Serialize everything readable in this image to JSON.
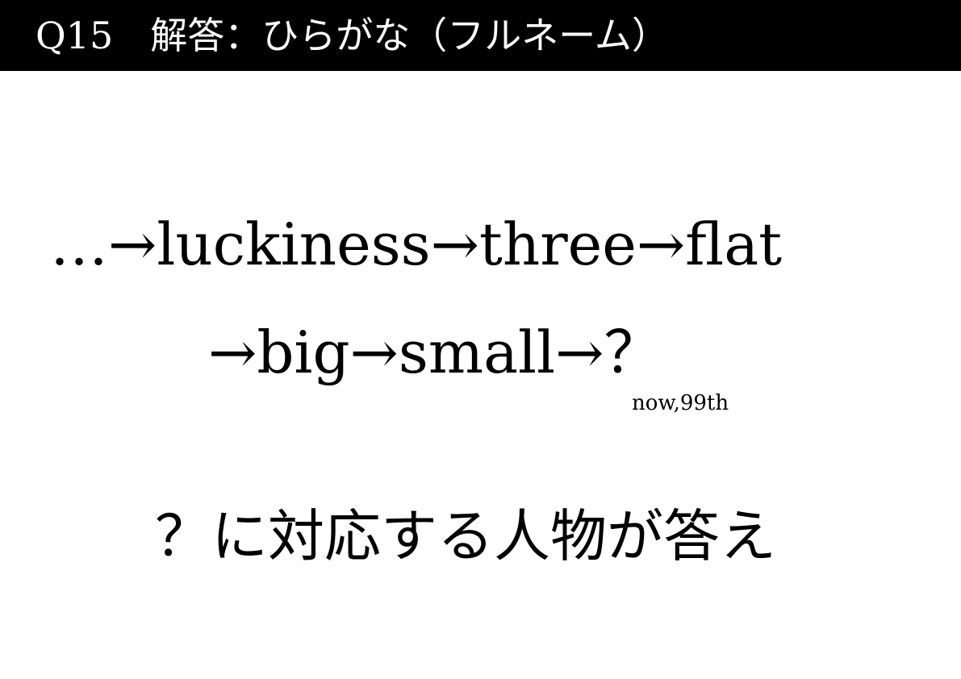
{
  "header": {
    "title": "Q15　解答：ひらがな（フルネーム）"
  },
  "sequence": {
    "line1": "…→luckiness→three→flat",
    "line2": "→big→small→？"
  },
  "note": "now,99th",
  "instruction": "？に対応する人物が答え"
}
